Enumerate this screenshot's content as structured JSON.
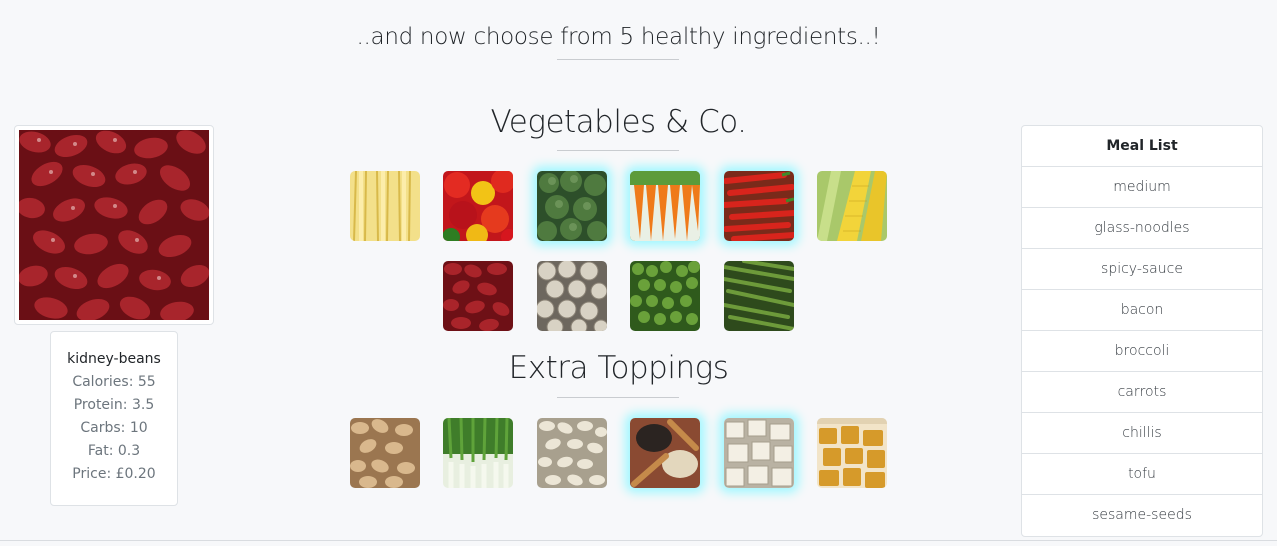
{
  "headline": "..and now choose from 5 healthy ingredients..!",
  "sections": {
    "vegetables_title": "Vegetables & Co.",
    "toppings_title": "Extra Toppings"
  },
  "vegetables": [
    {
      "name": "baby-corn",
      "selected": false
    },
    {
      "name": "peppers",
      "selected": false
    },
    {
      "name": "broccoli",
      "selected": true
    },
    {
      "name": "carrots",
      "selected": true
    },
    {
      "name": "chillis",
      "selected": true
    },
    {
      "name": "sweetcorn",
      "selected": false
    },
    {
      "name": "kidney-beans",
      "selected": false
    },
    {
      "name": "mushrooms",
      "selected": false
    },
    {
      "name": "peas",
      "selected": false
    },
    {
      "name": "green-beans",
      "selected": false
    }
  ],
  "toppings": [
    {
      "name": "cashews",
      "selected": false
    },
    {
      "name": "spring-onions",
      "selected": false
    },
    {
      "name": "white-beans",
      "selected": false
    },
    {
      "name": "sesame-seeds",
      "selected": true
    },
    {
      "name": "tofu",
      "selected": true
    },
    {
      "name": "fried-tofu",
      "selected": false
    }
  ],
  "preview": {
    "name": "kidney-beans",
    "calories": "Calories: 55",
    "protein": "Protein: 3.5",
    "carbs": "Carbs: 10",
    "fat": "Fat: 0.3",
    "price": "Price: £0.20"
  },
  "meal_list": {
    "title": "Meal List",
    "items": [
      "medium",
      "glass-noodles",
      "spicy-sauce",
      "bacon",
      "broccoli",
      "carrots",
      "chillis",
      "tofu",
      "sesame-seeds"
    ]
  },
  "colors": {
    "selected_glow": "#a3f7ff",
    "background": "#f7f8fa"
  }
}
